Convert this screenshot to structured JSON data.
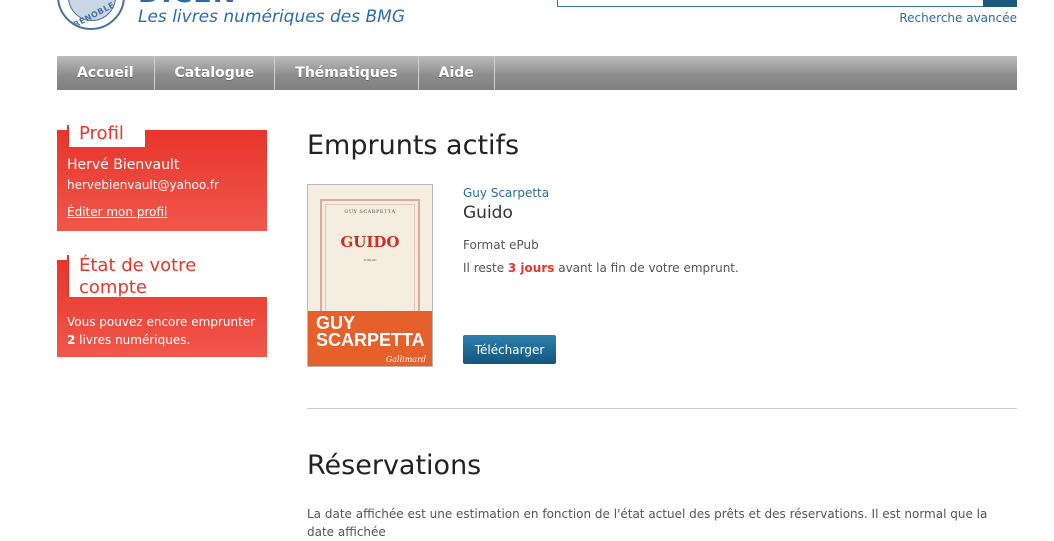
{
  "header": {
    "logo_ring_text": "GRENOBLE",
    "brand_name": "DICEN",
    "tagline": "Les livres numériques des BMG",
    "advanced_search": "Recherche avancée"
  },
  "nav": {
    "items": [
      {
        "label": "Accueil"
      },
      {
        "label": "Catalogue"
      },
      {
        "label": "Thématiques"
      },
      {
        "label": "Aide"
      }
    ]
  },
  "sidebar": {
    "profile": {
      "title": "Profil",
      "name": "Hervé Bienvault",
      "email": "hervebienvault@yahoo.fr",
      "edit_link": "Éditer mon profil"
    },
    "account": {
      "title": "État de votre compte",
      "text_before": "Vous pouvez encore emprunter ",
      "remaining_count": "2",
      "text_after": " livres numériques."
    }
  },
  "loans": {
    "title": "Emprunts actifs",
    "items": [
      {
        "cover": {
          "author_small": "GUY SCARPETTA",
          "title": "GUIDO",
          "subtitle": "roman",
          "author_big": "GUY SCARPETTA",
          "publisher": "Gallimard"
        },
        "author": "Guy Scarpetta",
        "title": "Guido",
        "format": "Format ePub",
        "remaining_prefix": "Il reste ",
        "remaining_days": "3 jours",
        "remaining_suffix": " avant la fin de votre emprunt.",
        "download_label": "Télécharger"
      }
    ]
  },
  "reservations": {
    "title": "Réservations",
    "note": "La date affichée est une estimation en fonction de l'état actuel des prêts et des réservations. Il est normal que la date affichée"
  },
  "colors": {
    "accent_red": "#e8352c",
    "link_blue": "#2a6e96",
    "button_blue": "#1c5a7c",
    "nav_grey": "#8e8e8e"
  }
}
